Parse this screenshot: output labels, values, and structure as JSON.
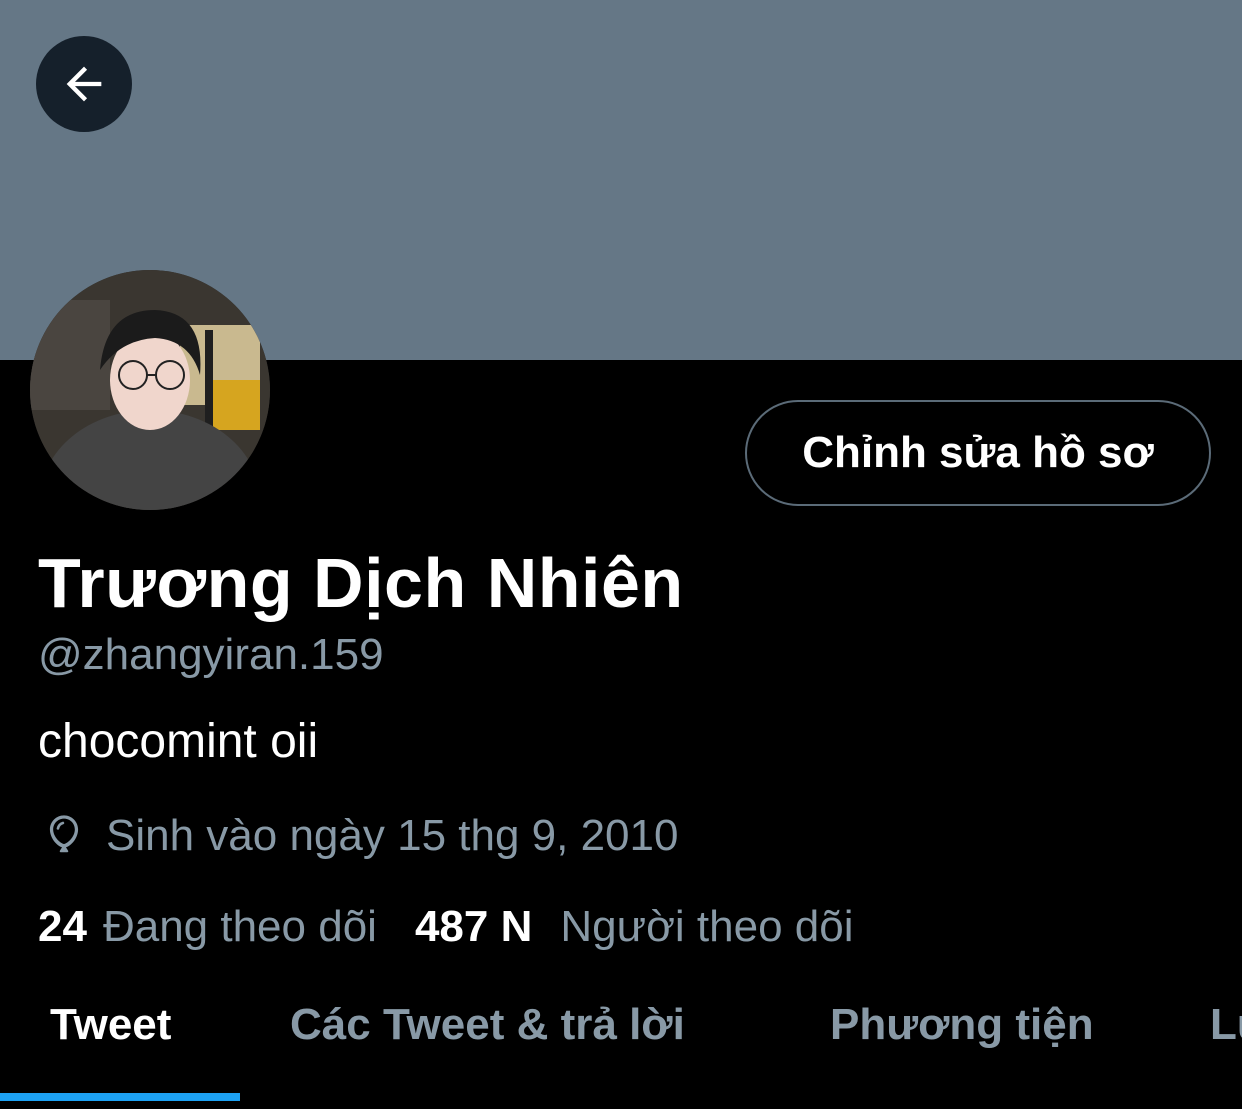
{
  "header": {
    "back_icon": "arrow-left-icon",
    "banner_color": "#657786"
  },
  "profile": {
    "display_name": "Trương Dịch Nhiên",
    "handle": "@zhangyiran.159",
    "bio": "chocomint oii",
    "birth_icon": "balloon-icon",
    "birth_text": "Sinh vào ngày 15 thg 9, 2010",
    "edit_button_label": "Chỉnh sửa hồ sơ"
  },
  "stats": {
    "following_count": "24",
    "following_label": "Đang theo dõi",
    "followers_count": "487 N",
    "followers_label": "Người theo dõi"
  },
  "tabs": [
    {
      "label": "Tweet",
      "active": true
    },
    {
      "label": "Các Tweet & trả lời",
      "active": false
    },
    {
      "label": "Phương tiện",
      "active": false
    },
    {
      "label": "Lư",
      "active": false
    }
  ],
  "colors": {
    "accent": "#1da1f2",
    "muted_text": "#8899a6",
    "background": "#000000"
  }
}
